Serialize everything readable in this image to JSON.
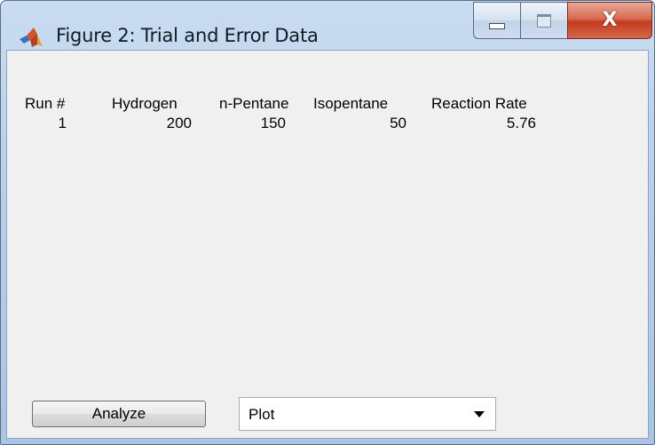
{
  "window": {
    "title": "Figure 2: Trial and Error Data",
    "app_icon": "matlab-logo-icon",
    "controls": {
      "minimize_icon": "minimize-icon",
      "maximize_icon": "maximize-icon",
      "close_label": "X"
    }
  },
  "table": {
    "headers": [
      "Run #",
      "Hydrogen",
      "n-Pentane",
      "Isopentane",
      "Reaction Rate"
    ],
    "rows": [
      [
        "1",
        "200",
        "150",
        "50",
        "5.76"
      ]
    ]
  },
  "controls": {
    "analyze_label": "Analyze",
    "plot_select_value": "Plot"
  },
  "colors": {
    "client_background": "#f0f0f0",
    "close_button": "#c43a1e",
    "titlebar": "#b9d0ea"
  }
}
